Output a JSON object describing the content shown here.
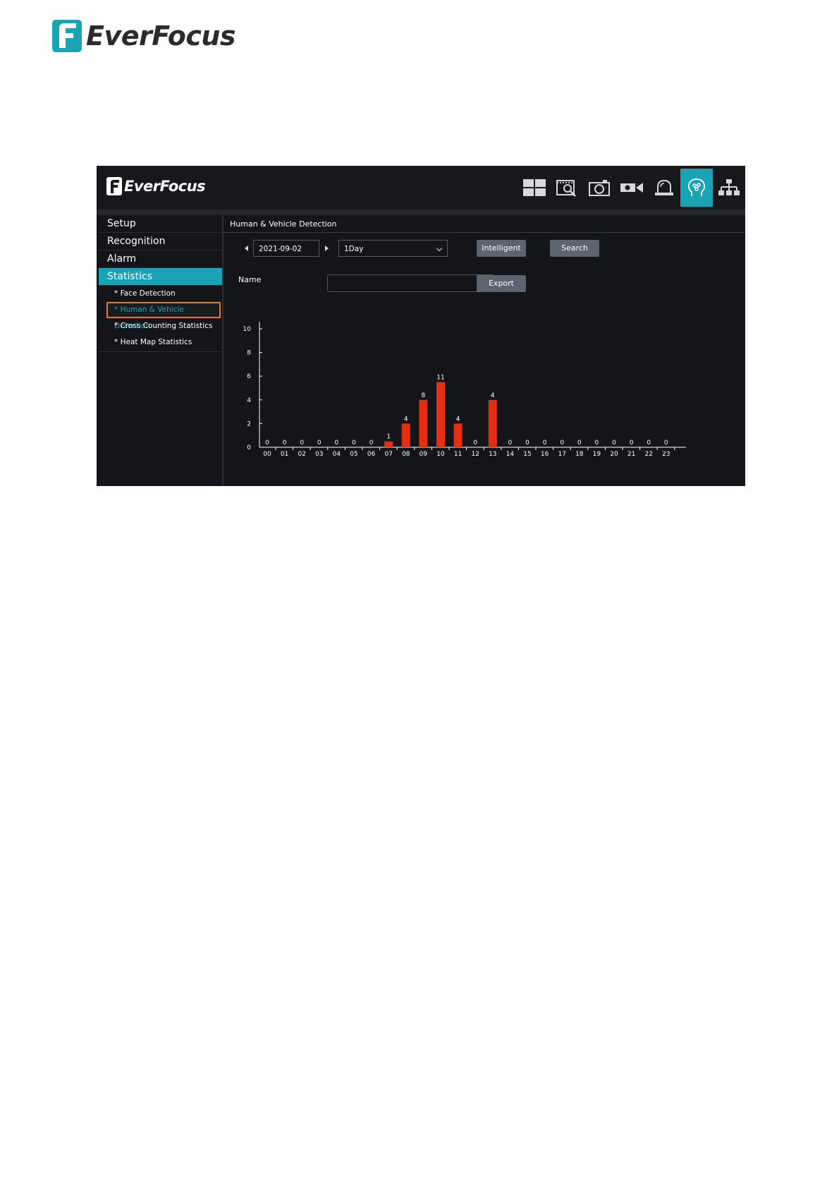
{
  "page_logo": {
    "brand": "EverFocus"
  },
  "app": {
    "logo": {
      "brand": "EverFocus"
    },
    "top_icons": [
      {
        "name": "layout-grid-icon",
        "active": false
      },
      {
        "name": "playback-search-icon",
        "active": false
      },
      {
        "name": "snapshot-camera-icon",
        "active": false
      },
      {
        "name": "video-camera-icon",
        "active": false
      },
      {
        "name": "alarm-bell-icon",
        "active": false
      },
      {
        "name": "intelligent-head-icon",
        "active": true
      },
      {
        "name": "network-icon",
        "active": false
      }
    ],
    "accent_color": "#1aa3b4",
    "highlight_color": "#e07a2f",
    "bar_color": "#e52d12",
    "sidebar": {
      "items": [
        {
          "label": "Setup"
        },
        {
          "label": "Recognition"
        },
        {
          "label": "Alarm"
        },
        {
          "label": "Statistics"
        }
      ],
      "sub_items": [
        {
          "label": "* Face Detection"
        },
        {
          "label": "* Human & Vehicle Detection"
        },
        {
          "label": "* Cross Counting Statistics"
        },
        {
          "label": "* Heat Map Statistics"
        }
      ]
    },
    "main": {
      "breadcrumb": "Human & Vehicle Detection",
      "date": "2021-09-02",
      "period": "1Day",
      "intelligent_label": "Intelligent",
      "search_label": "Search",
      "name_label": "Name",
      "name_value": "",
      "export_label": "Export"
    }
  },
  "chart_data": {
    "type": "bar",
    "categories": [
      "00",
      "01",
      "02",
      "03",
      "04",
      "05",
      "06",
      "07",
      "08",
      "09",
      "10",
      "11",
      "12",
      "13",
      "14",
      "15",
      "16",
      "17",
      "18",
      "19",
      "20",
      "21",
      "22",
      "23"
    ],
    "values": [
      0,
      0,
      0,
      0,
      0,
      0,
      0,
      0.5,
      2,
      4,
      5.5,
      2,
      0,
      4,
      0,
      0,
      0,
      0,
      0,
      0,
      0,
      0,
      0,
      0
    ],
    "data_labels": [
      "0",
      "0",
      "0",
      "0",
      "0",
      "0",
      "0",
      "1",
      "4",
      "8",
      "11",
      "4",
      "0",
      "4",
      "0",
      "0",
      "0",
      "0",
      "0",
      "0",
      "0",
      "0",
      "0",
      "0"
    ],
    "ylim": [
      0,
      10
    ],
    "yticks": [
      0,
      2,
      4,
      6,
      8,
      10
    ],
    "title": "",
    "xlabel": "",
    "ylabel": ""
  }
}
